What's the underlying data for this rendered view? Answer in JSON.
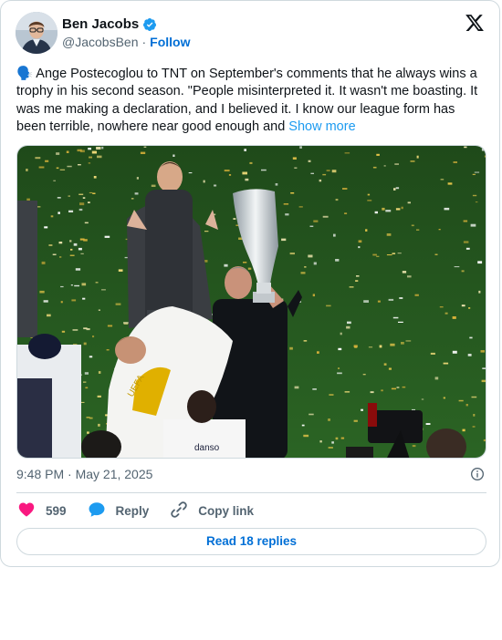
{
  "author": {
    "name": "Ben Jacobs",
    "handle": "@JacobsBen",
    "separator": "·",
    "follow_label": "Follow",
    "verified_icon": "verified-badge-icon"
  },
  "tweet": {
    "emoji": "🗣️",
    "text": " Ange Postecoglou to TNT on September's comments that he always wins a trophy in his second season. \"People misinterpreted it. It wasn't me boasting. It was me making a declaration, and I believed it. I know our league form has been terrible, nowhere near good enough and ",
    "show_more": "Show more"
  },
  "media": {
    "jersey_text": "danso",
    "flag_text": "UEFA"
  },
  "meta": {
    "timestamp": "9:48 PM · May 21, 2025"
  },
  "actions": {
    "like_count": "599",
    "reply_label": "Reply",
    "copy_link_label": "Copy link",
    "read_replies_label": "Read 18 replies"
  },
  "colors": {
    "like": "#f91880",
    "reply": "#1d9bf0",
    "link": "#006fd6",
    "verified": "#1d9bf0"
  }
}
